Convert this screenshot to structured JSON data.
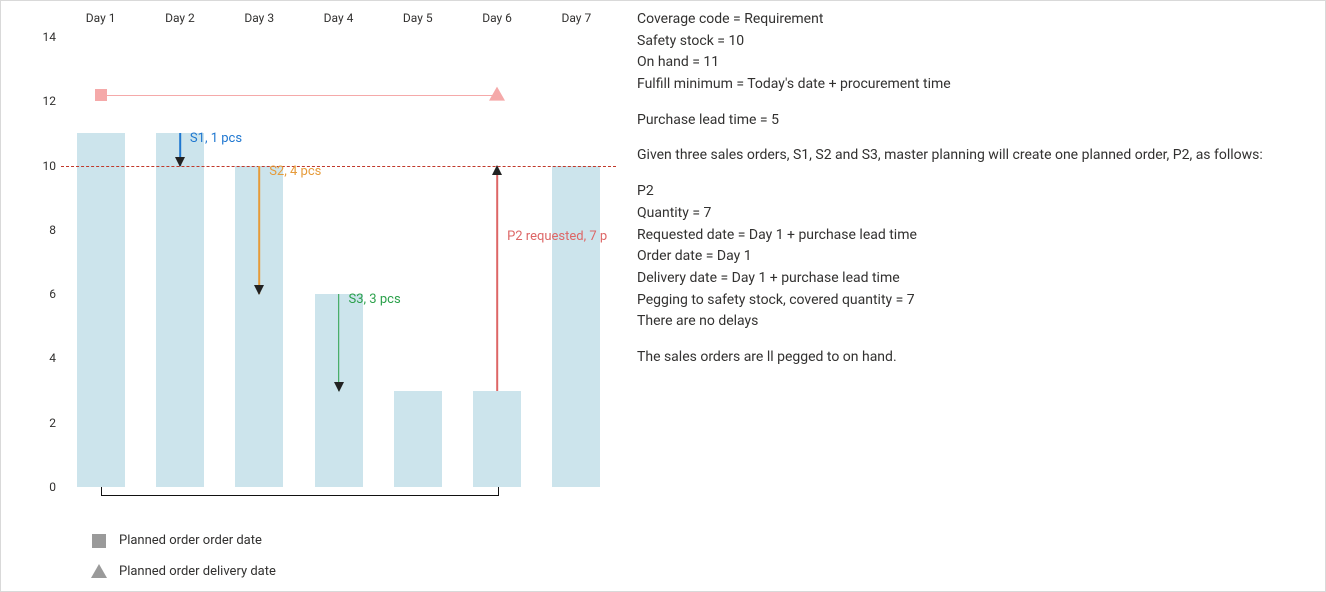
{
  "chart_data": {
    "type": "bar",
    "categories": [
      "Day 1",
      "Day 2",
      "Day 3",
      "Day 4",
      "Day 5",
      "Day 6",
      "Day 7"
    ],
    "values": [
      11,
      11,
      10,
      6,
      3,
      3,
      10
    ],
    "title": "",
    "xlabel": "",
    "ylabel": "",
    "ylim": [
      0,
      14
    ],
    "yticks": [
      0,
      2,
      4,
      6,
      8,
      10,
      12,
      14
    ],
    "safety_stock_line": 10,
    "planned_order_line": {
      "y": 12.2,
      "start_day": 1,
      "end_day": 6
    },
    "annotations": [
      {
        "id": "S1",
        "label": "S1, 1 pcs",
        "day": 2,
        "from": 11,
        "to": 10,
        "color": "#1f77d0"
      },
      {
        "id": "S2",
        "label": "S2, 4 pcs",
        "day": 3,
        "from": 10,
        "to": 6,
        "color": "#e69b3a"
      },
      {
        "id": "S3",
        "label": "S3, 3 pcs",
        "day": 4,
        "from": 6,
        "to": 3,
        "color": "#2aa04a"
      },
      {
        "id": "P2",
        "label": "P2 requested, 7 p",
        "day": 6,
        "from": 3,
        "to": 10,
        "color": "#d66"
      }
    ]
  },
  "legend": {
    "order_date": "Planned order order date",
    "delivery_date": "Planned order delivery date"
  },
  "info": {
    "coverage_code": "Coverage code = Requirement",
    "safety_stock": "Safety stock = 10",
    "on_hand": "On hand = 11",
    "fulfill_minimum": "Fulfill minimum = Today's date + procurement time",
    "purchase_lead_time": "Purchase lead time = 5",
    "given": "Given three sales orders, S1, S2 and S3, master planning will create one planned order, P2, as follows:",
    "p2_header": "P2",
    "p2_qty": "Quantity = 7",
    "p2_requested": "Requested date = Day 1 + purchase lead time",
    "p2_order": "Order date = Day 1",
    "p2_delivery": "Delivery date = Day 1 + purchase lead time",
    "p2_pegging": "Pegging to safety stock, covered quantity = 7",
    "p2_delays": "There are no delays",
    "footnote": " The sales orders are ll pegged to on hand."
  }
}
